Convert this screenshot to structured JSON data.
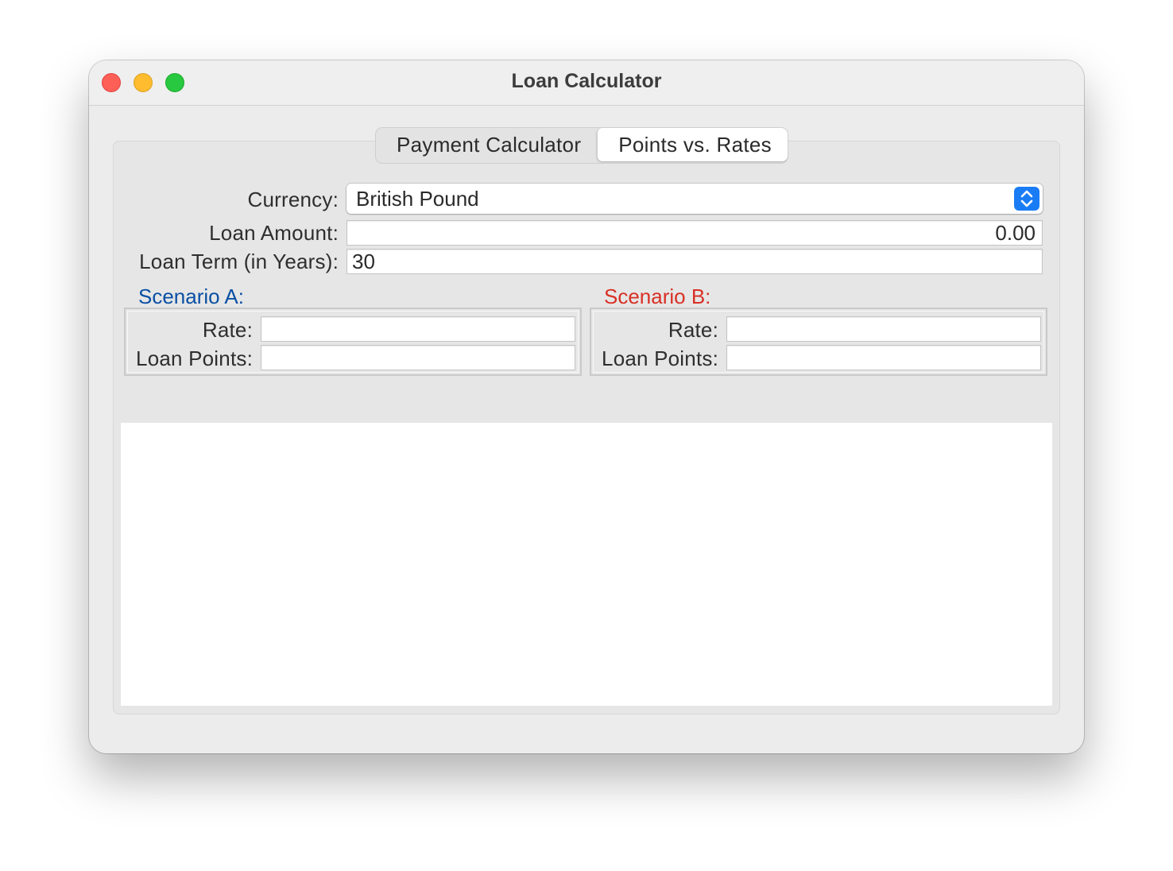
{
  "window": {
    "title": "Loan Calculator"
  },
  "tabs": [
    {
      "label": "Payment Calculator",
      "selected": false
    },
    {
      "label": "Points vs. Rates",
      "selected": true
    }
  ],
  "form": {
    "currency_label": "Currency:",
    "currency_value": "British Pound",
    "loan_amount_label": "Loan Amount:",
    "loan_amount_value": "0.00",
    "loan_term_label": "Loan Term (in Years):",
    "loan_term_value": "30"
  },
  "scenario_a": {
    "title": "Scenario A:",
    "title_color": "#0a4fa3",
    "rate_label": "Rate:",
    "rate_value": "",
    "points_label": "Loan Points:",
    "points_value": ""
  },
  "scenario_b": {
    "title": "Scenario B:",
    "title_color": "#d93025",
    "rate_label": "Rate:",
    "rate_value": "",
    "points_label": "Loan Points:",
    "points_value": ""
  },
  "colors": {
    "accent": "#1a7cf5",
    "close": "#fe5f57",
    "minimize": "#febc2e",
    "zoom": "#28c840"
  },
  "icons": {
    "select_arrows": "chevron-up-down-icon"
  }
}
